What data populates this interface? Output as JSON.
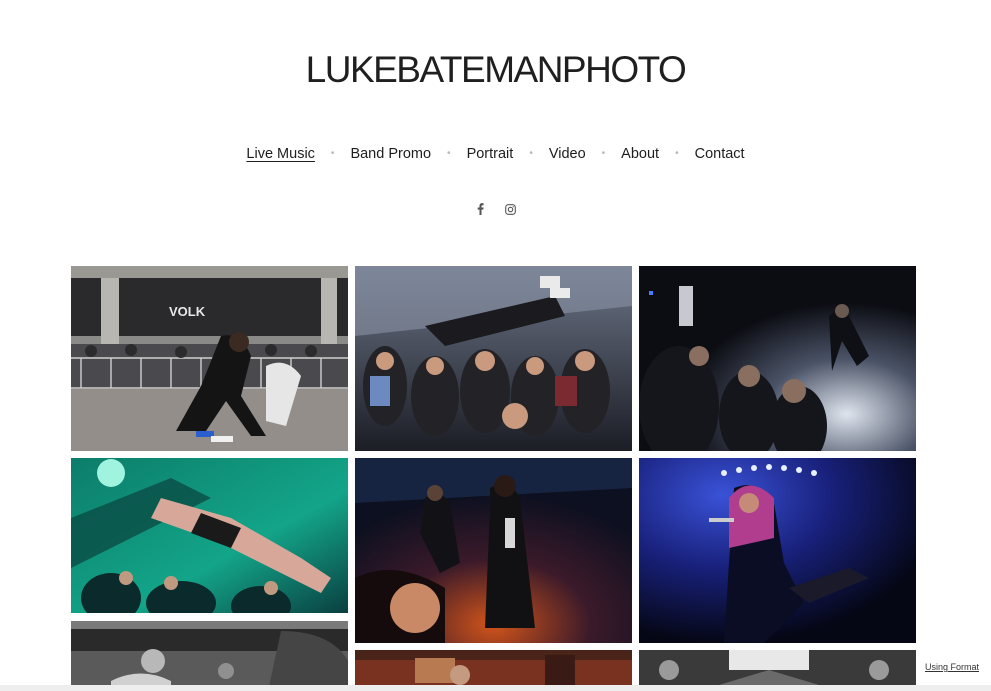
{
  "site": {
    "title": "LUKEBATEMANPHOTO"
  },
  "nav": {
    "items": [
      {
        "label": "Live Music",
        "active": true
      },
      {
        "label": "Band Promo",
        "active": false
      },
      {
        "label": "Portrait",
        "active": false
      },
      {
        "label": "Video",
        "active": false
      },
      {
        "label": "About",
        "active": false
      },
      {
        "label": "Contact",
        "active": false
      }
    ]
  },
  "social": {
    "icons": [
      "facebook-icon",
      "instagram-icon"
    ]
  },
  "photos": [
    {
      "name": "photo-singer-kneeling-outdoor",
      "sign_text": "VOLK"
    },
    {
      "name": "photo-crowd-surfer"
    },
    {
      "name": "photo-crowd-guitarist-blue"
    },
    {
      "name": "photo-green-stage-diver"
    },
    {
      "name": "photo-singer-red-stage"
    },
    {
      "name": "photo-singer-purple-hair"
    },
    {
      "name": "photo-bw-singer"
    },
    {
      "name": "photo-warm-stage"
    },
    {
      "name": "photo-bright-lights"
    }
  ],
  "footer": {
    "format_link": "Using Format"
  },
  "colors": {
    "accent": "#1f1f1f",
    "nav_dot": "#b8b8b8"
  }
}
